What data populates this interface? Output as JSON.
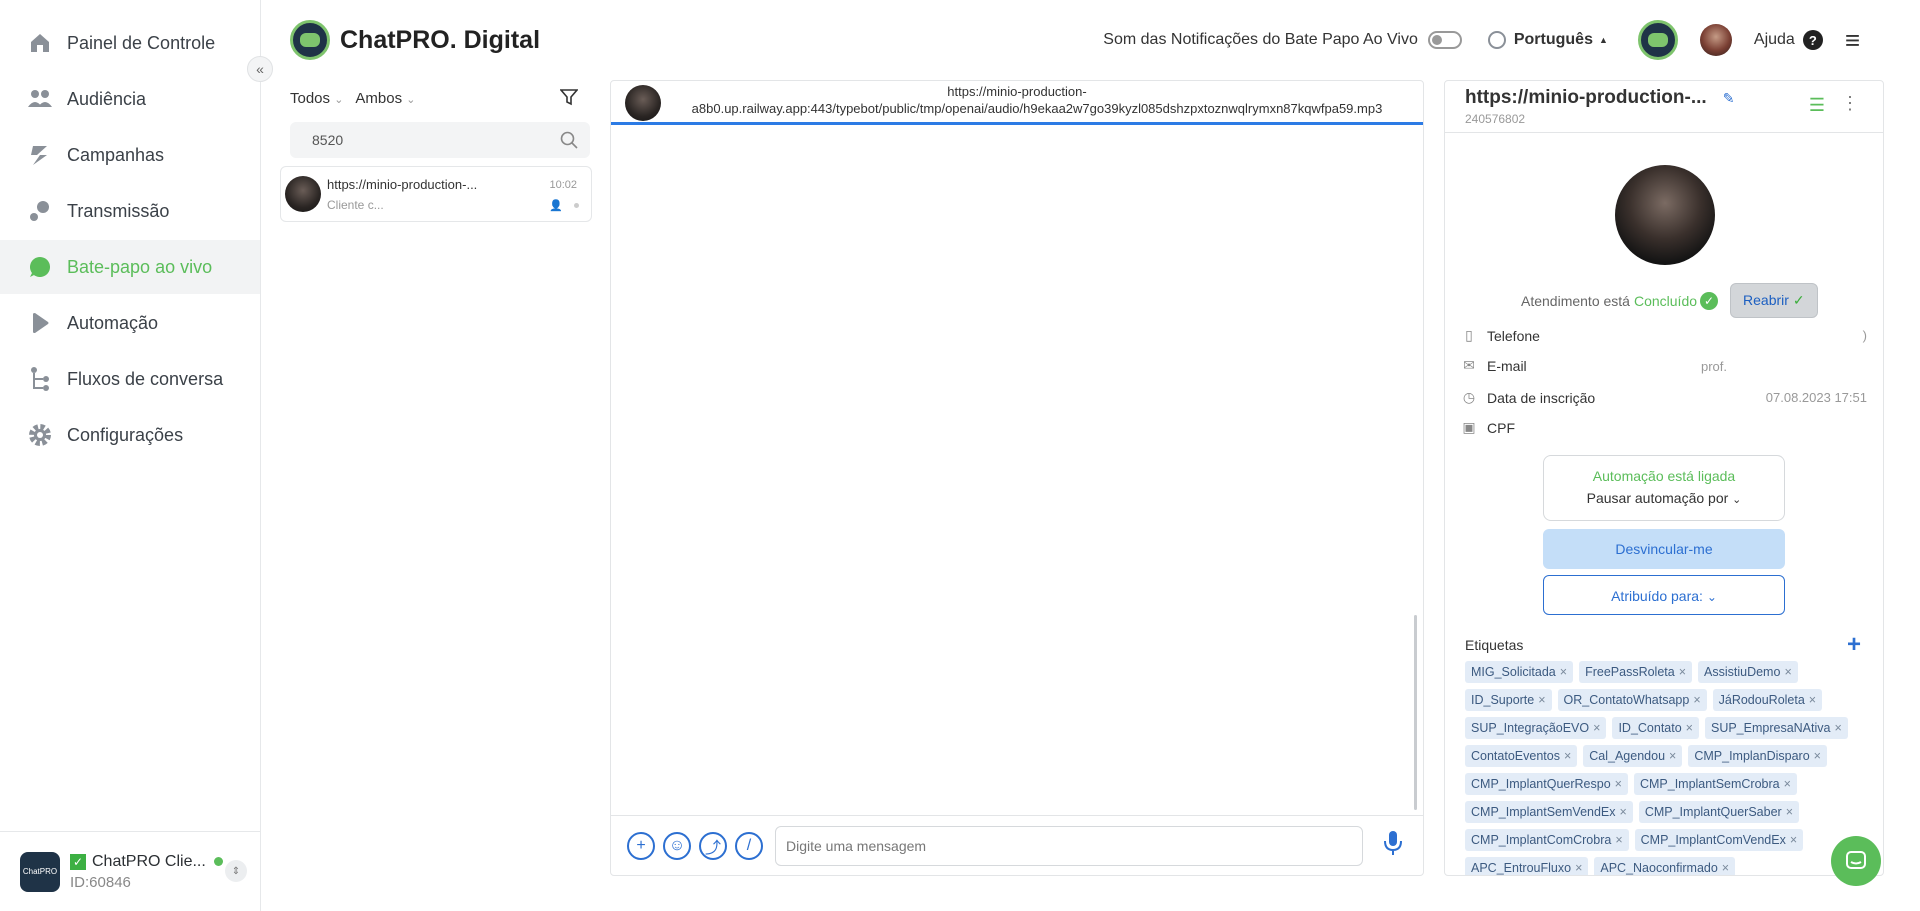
{
  "sidebar": {
    "items": [
      {
        "label": "Painel de Controle",
        "icon": "home-icon"
      },
      {
        "label": "Audiência",
        "icon": "people-icon"
      },
      {
        "label": "Campanhas",
        "icon": "campaign-icon"
      },
      {
        "label": "Transmissão",
        "icon": "broadcast-icon"
      },
      {
        "label": "Bate-papo ao vivo",
        "icon": "chat-icon",
        "active": true
      },
      {
        "label": "Automação",
        "icon": "automation-icon"
      },
      {
        "label": "Fluxos de conversa",
        "icon": "flow-icon"
      },
      {
        "label": "Configurações",
        "icon": "gear-icon"
      }
    ],
    "account": {
      "name": "ChatPRO Clie...",
      "id": "ID:60846",
      "logo_text": "ChatPRO"
    }
  },
  "header": {
    "brand": "ChatPRO. Digital",
    "notif_label": "Som das Notificações do Bate Papo Ao Vivo",
    "language": "Português",
    "help": "Ajuda"
  },
  "chat_list": {
    "filter_all": "Todos",
    "filter_both": "Ambos",
    "search_value": "8520",
    "conversation": {
      "title": "https://minio-production-...",
      "preview": "Cliente c...",
      "time": "10:02"
    }
  },
  "chat": {
    "header_line1": "https://minio-production-",
    "header_line2": "a8b0.up.railway.app:443/typebot/public/tmp/openai/audio/h9ekaa2w7go39kyzl085dshzpxtoznwqlrymxn87kqwfpa59.mp3",
    "input_placeholder": "Digite uma mensagem"
  },
  "details": {
    "title": "https://minio-production-...",
    "id": "240576802",
    "status_prefix": "Atendimento está",
    "status_value": "Concluído",
    "reopen_label": "Reabrir",
    "fields": [
      {
        "label": "Telefone",
        "value": ")"
      },
      {
        "label": "E-mail",
        "value": "prof."
      },
      {
        "label": "Data de inscrição",
        "value": "07.08.2023 17:51"
      },
      {
        "label": "CPF",
        "value": ""
      }
    ],
    "automation_on": "Automação está ligada",
    "pause_automation": "Pausar automação por",
    "unlink_label": "Desvincular-me",
    "assigned_label": "Atribuído para:",
    "tags_title": "Etiquetas",
    "tags": [
      "MIG_Solicitada",
      "FreePassRoleta",
      "AssistiuDemo",
      "ID_Suporte",
      "OR_ContatoWhatsapp",
      "JáRodouRoleta",
      "SUP_IntegraçãoEVO",
      "ID_Contato",
      "SUP_EmpresaNAtiva",
      "ContatoEventos",
      "Cal_Agendou",
      "CMP_ImplanDisparo",
      "CMP_ImplantQuerRespo",
      "CMP_ImplantSemCrobra",
      "CMP_ImplantSemVendEx",
      "CMP_ImplantQuerSaber",
      "CMP_ImplantComCrobra",
      "CMP_ImplantComVendEx",
      "APC_EntrouFluxo",
      "APC_Naoconfirmado"
    ]
  },
  "colors": {
    "accent_green": "#5bbd5a",
    "accent_blue": "#2c6fd1"
  }
}
